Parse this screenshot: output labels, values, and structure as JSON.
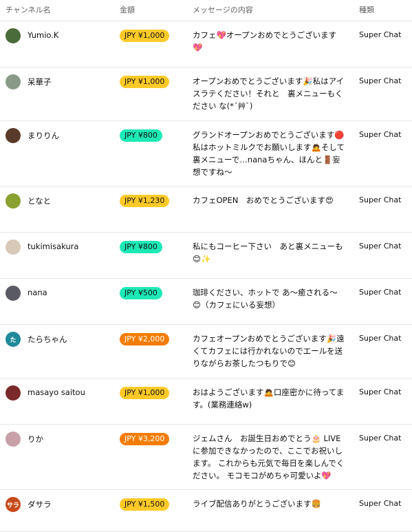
{
  "header": {
    "channel": "チャンネル名",
    "amount": "金額",
    "message": "メッセージの内容",
    "type": "種類"
  },
  "rows": [
    {
      "channel": "Yumio.K",
      "amount": "JPY ¥1,000",
      "tier": "yellow",
      "message": "カフェ💖オープンおめでとうございます💖",
      "type": "Super Chat",
      "avatar_color": "#4a6b3a",
      "avatar_text": ""
    },
    {
      "channel": "呆華子",
      "amount": "JPY ¥1,000",
      "tier": "yellow",
      "message": "オープンおめでとうございます🎉私はアイスラテください！それと　裏メニューもください な(*´艸`)",
      "type": "Super Chat",
      "avatar_color": "#8a9a88",
      "avatar_text": ""
    },
    {
      "channel": "まりりん",
      "amount": "JPY ¥800",
      "tier": "green",
      "message": "グランドオープンおめでとうございます🔴私はホットミルクでお願いします🙇そして裏メニューで…nanaちゃん、ほんと🚪妄想ですね～",
      "type": "Super Chat",
      "avatar_color": "#5a3a2a",
      "avatar_text": ""
    },
    {
      "channel": "となと",
      "amount": "JPY ¥1,230",
      "tier": "yellow",
      "message": "カフェOPEN　おめでとうございます😍",
      "type": "Super Chat",
      "avatar_color": "#8aa030",
      "avatar_text": ""
    },
    {
      "channel": "tukimisakura",
      "amount": "JPY ¥800",
      "tier": "green",
      "message": "私にもコーヒー下さい　あと裏メニューも😊✨",
      "type": "Super Chat",
      "avatar_color": "#d8c8b8",
      "avatar_text": ""
    },
    {
      "channel": "nana",
      "amount": "JPY ¥500",
      "tier": "green",
      "message": "珈琲ください、ホットで あ～癒される～😊（カフェにいる妄想）",
      "type": "Super Chat",
      "avatar_color": "#5a5a62",
      "avatar_text": ""
    },
    {
      "channel": "たらちゃん",
      "amount": "JPY ¥2,000",
      "tier": "orange",
      "message": "カフェオープンおめでとうございます🎉遠くてカフェには行かれないのでエールを送りながらお茶したつもりで😊",
      "type": "Super Chat",
      "avatar_color": "#1f8a9a",
      "avatar_text": "た"
    },
    {
      "channel": "masayo saitou",
      "amount": "JPY ¥1,000",
      "tier": "yellow",
      "message": "おはようございます🙇口座密かに待ってます。(業務連絡w)",
      "type": "Super Chat",
      "avatar_color": "#7a2a2a",
      "avatar_text": ""
    },
    {
      "channel": "りか",
      "amount": "JPY ¥3,200",
      "tier": "orange",
      "message": "ジェムさん　お誕生日おめでとう🎂 LIVEに参加できなかったので、ここでお祝いします。 これからも元気で毎日を楽しんでください。 モコモコがめちゃ可愛いよ💖",
      "type": "Super Chat",
      "avatar_color": "#c8a0a8",
      "avatar_text": ""
    },
    {
      "channel": "ダサラ",
      "amount": "JPY ¥1,500",
      "tier": "yellow",
      "message": "ライブ配信ありがとうございます🍔",
      "type": "Super Chat",
      "avatar_color": "#c84a1a",
      "avatar_text": "サラ"
    }
  ],
  "colors": {
    "yellow": "#ffca28",
    "green": "#1de9b6",
    "orange": "#f57c00"
  }
}
